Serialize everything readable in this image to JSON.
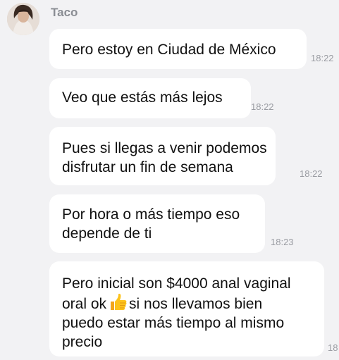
{
  "chat": {
    "sender": "Taco",
    "messages": [
      {
        "text": "Pero estoy en Ciudad de México",
        "time": "18:22"
      },
      {
        "text": "Veo que estás más lejos",
        "time": "18:22"
      },
      {
        "text": "Pues si llegas a venir podemos\ndisfrutar un fin de semana",
        "time": "18:22"
      },
      {
        "text": "Por hora o más tiempo eso\ndepende de ti",
        "time": "18:23"
      },
      {
        "text_before_icon": "Pero inicial son $4000 anal vaginal\noral ok",
        "icon": "thumbs-up-icon",
        "text_after_icon": "si nos llevamos bien\npuedo estar más tiempo al mismo\nprecio",
        "time": "18"
      }
    ]
  },
  "colors": {
    "background": "#f2f2f4",
    "bubble": "#ffffff",
    "sender": "#8a8d93",
    "timestamp": "#9a9ca2"
  }
}
